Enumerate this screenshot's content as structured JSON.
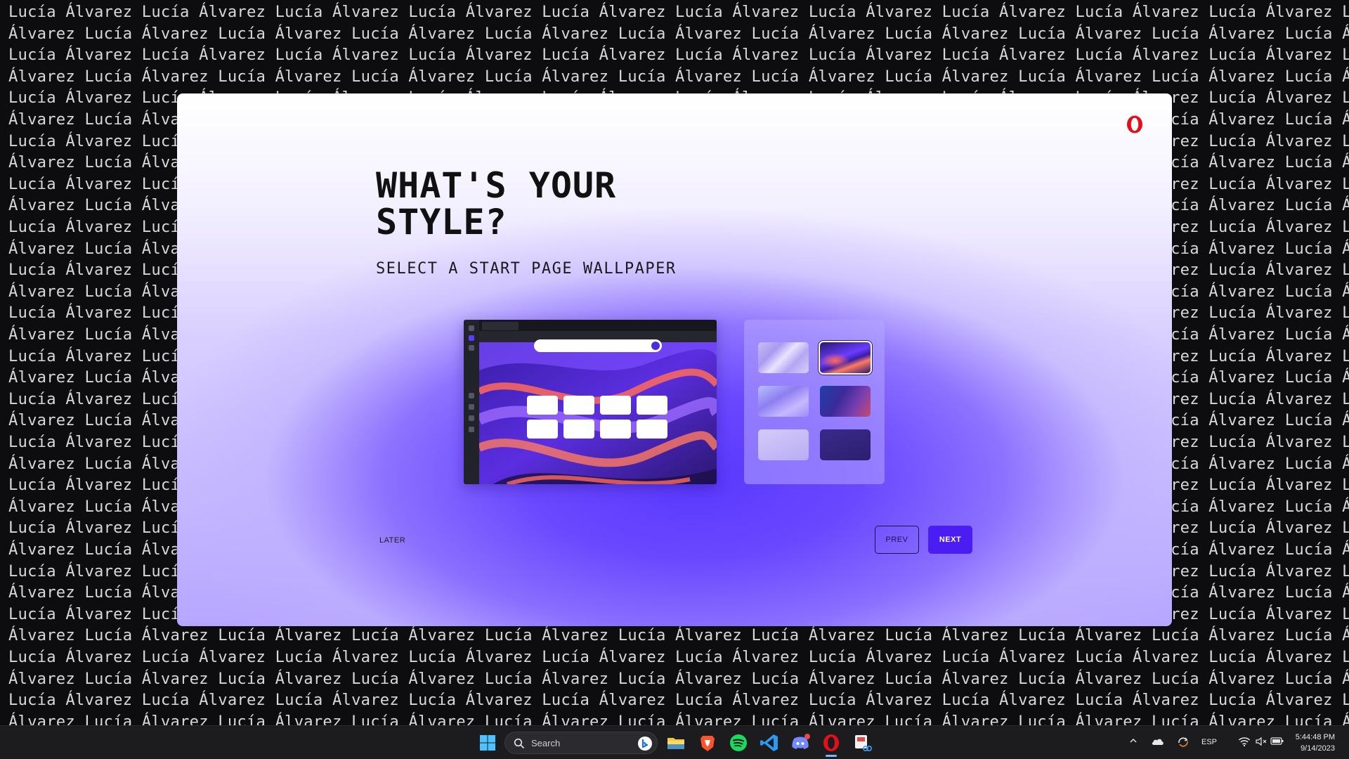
{
  "wallpaper": {
    "word_a": "Lucía",
    "word_b": "Álvarez"
  },
  "dialog": {
    "title_line1": "WHAT'S YOUR",
    "title_line2": "STYLE?",
    "subtitle": "SELECT A START PAGE WALLPAPER",
    "later_label": "LATER",
    "prev_label": "PREV",
    "next_label": "NEXT",
    "selected_wallpaper": 2,
    "wallpapers": [
      {
        "name": "lilac-waves",
        "selected": false
      },
      {
        "name": "purple-swirl",
        "selected": true
      },
      {
        "name": "soft-gradient",
        "selected": false
      },
      {
        "name": "deep-blue-red",
        "selected": false
      },
      {
        "name": "lavender",
        "selected": false
      },
      {
        "name": "dark-indigo",
        "selected": false
      }
    ]
  },
  "taskbar": {
    "search_placeholder": "Search",
    "apps": [
      "file-explorer",
      "brave",
      "spotify",
      "vs-code",
      "discord",
      "opera",
      "snipping-tool"
    ],
    "language": "ESP",
    "time": "5:44:48 PM",
    "date": "9/14/2023"
  },
  "colors": {
    "accent": "#4b1df2",
    "opera_red": "#e3101b"
  }
}
